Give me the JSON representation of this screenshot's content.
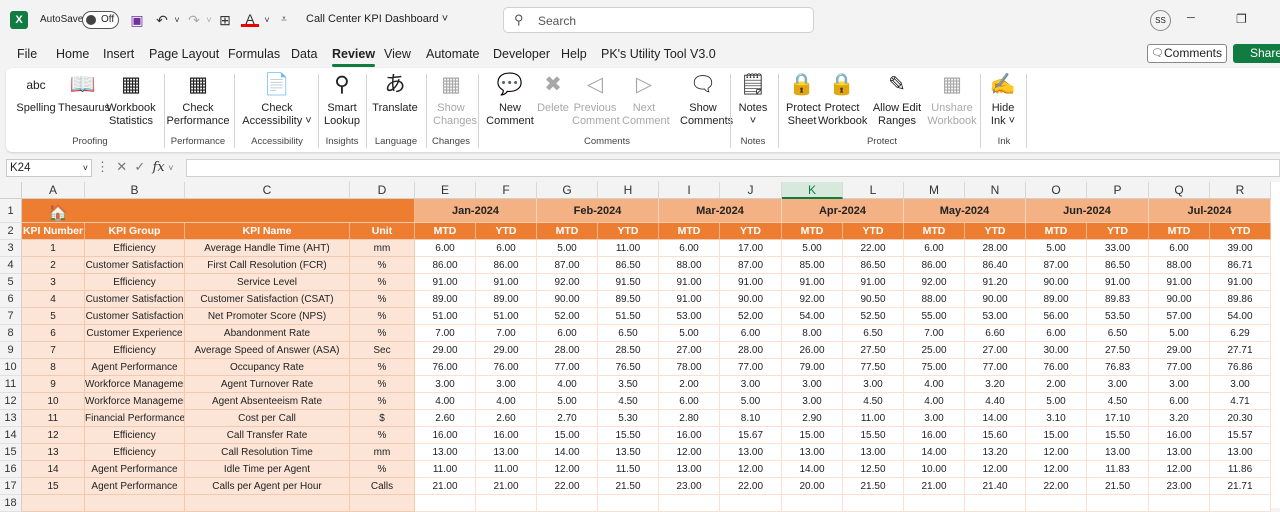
{
  "app": {
    "autosave_label": "AutoSave",
    "autosave_state": "Off",
    "doc_title": "Call Center KPI Dashboard",
    "search_placeholder": "Search",
    "user_initials": "SS"
  },
  "menu": [
    "File",
    "Home",
    "Insert",
    "Page Layout",
    "Formulas",
    "Data",
    "Review",
    "View",
    "Automate",
    "Developer",
    "Help",
    "PK's Utility Tool V3.0"
  ],
  "menu_active": "Review",
  "buttons": {
    "comments": "Comments",
    "share": "Share"
  },
  "ribbon": {
    "items": [
      {
        "l1": "Spelling",
        "l2": "",
        "icon": "spelling-icon",
        "g": "abc"
      },
      {
        "l1": "Thesaurus",
        "l2": "",
        "icon": "thesaurus-icon",
        "g": "📖"
      },
      {
        "l1": "Workbook",
        "l2": "Statistics",
        "icon": "statistics-icon",
        "g": "▦"
      },
      {
        "l1": "Check",
        "l2": "Performance",
        "icon": "performance-icon",
        "g": "▦"
      },
      {
        "l1": "Check",
        "l2": "Accessibility ˅",
        "icon": "accessibility-icon",
        "g": "📄"
      },
      {
        "l1": "Smart",
        "l2": "Lookup",
        "icon": "smart-lookup-icon",
        "g": "⚲"
      },
      {
        "l1": "Translate",
        "l2": "",
        "icon": "translate-icon",
        "g": "あ"
      },
      {
        "l1": "Show",
        "l2": "Changes",
        "icon": "show-changes-icon",
        "g": "▦",
        "dis": true
      },
      {
        "l1": "New",
        "l2": "Comment",
        "icon": "new-comment-icon",
        "g": "💬"
      },
      {
        "l1": "Delete",
        "l2": "",
        "icon": "delete-comment-icon",
        "g": "✖",
        "dis": true
      },
      {
        "l1": "Previous",
        "l2": "Comment",
        "icon": "previous-comment-icon",
        "g": "◁",
        "dis": true
      },
      {
        "l1": "Next",
        "l2": "Comment",
        "icon": "next-comment-icon",
        "g": "▷",
        "dis": true
      },
      {
        "l1": "Show",
        "l2": "Comments",
        "icon": "show-comments-icon",
        "g": "🗨"
      },
      {
        "l1": "Notes",
        "l2": "˅",
        "icon": "notes-icon",
        "g": "🗒"
      },
      {
        "l1": "Protect",
        "l2": "Sheet",
        "icon": "protect-sheet-icon",
        "g": "🔒"
      },
      {
        "l1": "Protect",
        "l2": "Workbook",
        "icon": "protect-workbook-icon",
        "g": "🔒"
      },
      {
        "l1": "Allow Edit",
        "l2": "Ranges",
        "icon": "allow-edit-ranges-icon",
        "g": "✎"
      },
      {
        "l1": "Unshare",
        "l2": "Workbook",
        "icon": "unshare-workbook-icon",
        "g": "▦",
        "dis": true
      },
      {
        "l1": "Hide",
        "l2": "Ink ˅",
        "icon": "hide-ink-icon",
        "g": "✍"
      }
    ],
    "groups": [
      "Proofing",
      "Performance",
      "Accessibility",
      "Insights",
      "Language",
      "Changes",
      "Comments",
      "Notes",
      "Protect",
      "Ink"
    ]
  },
  "formula_bar": {
    "name_box": "K24",
    "fx": "fx",
    "value": ""
  },
  "columns": [
    "A",
    "B",
    "C",
    "D",
    "E",
    "F",
    "G",
    "H",
    "I",
    "J",
    "K",
    "L",
    "M",
    "N",
    "O",
    "P",
    "Q",
    "R"
  ],
  "selected_column": "K",
  "rows": [
    "1",
    "2",
    "3",
    "4",
    "5",
    "6",
    "7",
    "8",
    "9",
    "10",
    "11",
    "12",
    "13",
    "14",
    "15",
    "16",
    "17",
    "18"
  ],
  "sheet": {
    "months": [
      "Jan-2024",
      "Feb-2024",
      "Mar-2024",
      "Apr-2024",
      "May-2024",
      "Jun-2024",
      "Jul-2024"
    ],
    "headers": [
      "KPI Number",
      "KPI Group",
      "KPI Name",
      "Unit"
    ],
    "mtd": "MTD",
    "ytd": "YTD",
    "kpis": [
      [
        "1",
        "Efficiency",
        "Average Handle Time (AHT)",
        "mm",
        "6.00",
        "6.00",
        "5.00",
        "11.00",
        "6.00",
        "17.00",
        "5.00",
        "22.00",
        "6.00",
        "28.00",
        "5.00",
        "33.00",
        "6.00",
        "39.00"
      ],
      [
        "2",
        "Customer Satisfaction",
        "First Call Resolution (FCR)",
        "%",
        "86.00",
        "86.00",
        "87.00",
        "86.50",
        "88.00",
        "87.00",
        "85.00",
        "86.50",
        "86.00",
        "86.40",
        "87.00",
        "86.50",
        "88.00",
        "86.71"
      ],
      [
        "3",
        "Efficiency",
        "Service Level",
        "%",
        "91.00",
        "91.00",
        "92.00",
        "91.50",
        "91.00",
        "91.00",
        "91.00",
        "91.00",
        "92.00",
        "91.20",
        "90.00",
        "91.00",
        "91.00",
        "91.00"
      ],
      [
        "4",
        "Customer Satisfaction",
        "Customer Satisfaction (CSAT)",
        "%",
        "89.00",
        "89.00",
        "90.00",
        "89.50",
        "91.00",
        "90.00",
        "92.00",
        "90.50",
        "88.00",
        "90.00",
        "89.00",
        "89.83",
        "90.00",
        "89.86"
      ],
      [
        "5",
        "Customer Satisfaction",
        "Net Promoter Score (NPS)",
        "%",
        "51.00",
        "51.00",
        "52.00",
        "51.50",
        "53.00",
        "52.00",
        "54.00",
        "52.50",
        "55.00",
        "53.00",
        "56.00",
        "53.50",
        "57.00",
        "54.00"
      ],
      [
        "6",
        "Customer Experience",
        "Abandonment Rate",
        "%",
        "7.00",
        "7.00",
        "6.00",
        "6.50",
        "5.00",
        "6.00",
        "8.00",
        "6.50",
        "7.00",
        "6.60",
        "6.00",
        "6.50",
        "5.00",
        "6.29"
      ],
      [
        "7",
        "Efficiency",
        "Average Speed of Answer (ASA)",
        "Sec",
        "29.00",
        "29.00",
        "28.00",
        "28.50",
        "27.00",
        "28.00",
        "26.00",
        "27.50",
        "25.00",
        "27.00",
        "30.00",
        "27.50",
        "29.00",
        "27.71"
      ],
      [
        "8",
        "Agent Performance",
        "Occupancy Rate",
        "%",
        "76.00",
        "76.00",
        "77.00",
        "76.50",
        "78.00",
        "77.00",
        "79.00",
        "77.50",
        "75.00",
        "77.00",
        "76.00",
        "76.83",
        "77.00",
        "76.86"
      ],
      [
        "9",
        "Workforce Management",
        "Agent Turnover Rate",
        "%",
        "3.00",
        "3.00",
        "4.00",
        "3.50",
        "2.00",
        "3.00",
        "3.00",
        "3.00",
        "4.00",
        "3.20",
        "2.00",
        "3.00",
        "3.00",
        "3.00"
      ],
      [
        "10",
        "Workforce Management",
        "Agent Absenteeism Rate",
        "%",
        "4.00",
        "4.00",
        "5.00",
        "4.50",
        "6.00",
        "5.00",
        "3.00",
        "4.50",
        "4.00",
        "4.40",
        "5.00",
        "4.50",
        "6.00",
        "4.71"
      ],
      [
        "11",
        "Financial Performance",
        "Cost per Call",
        "$",
        "2.60",
        "2.60",
        "2.70",
        "5.30",
        "2.80",
        "8.10",
        "2.90",
        "11.00",
        "3.00",
        "14.00",
        "3.10",
        "17.10",
        "3.20",
        "20.30"
      ],
      [
        "12",
        "Efficiency",
        "Call Transfer Rate",
        "%",
        "16.00",
        "16.00",
        "15.00",
        "15.50",
        "16.00",
        "15.67",
        "15.00",
        "15.50",
        "16.00",
        "15.60",
        "15.00",
        "15.50",
        "16.00",
        "15.57"
      ],
      [
        "13",
        "Efficiency",
        "Call Resolution Time",
        "mm",
        "13.00",
        "13.00",
        "14.00",
        "13.50",
        "12.00",
        "13.00",
        "13.00",
        "13.00",
        "14.00",
        "13.20",
        "12.00",
        "13.00",
        "13.00",
        "13.00"
      ],
      [
        "14",
        "Agent Performance",
        "Idle Time per Agent",
        "%",
        "11.00",
        "11.00",
        "12.00",
        "11.50",
        "13.00",
        "12.00",
        "14.00",
        "12.50",
        "10.00",
        "12.00",
        "12.00",
        "11.83",
        "12.00",
        "11.86"
      ],
      [
        "15",
        "Agent Performance",
        "Calls per Agent per Hour",
        "Calls",
        "21.00",
        "21.00",
        "22.00",
        "21.50",
        "23.00",
        "22.00",
        "20.00",
        "21.50",
        "21.00",
        "21.40",
        "22.00",
        "21.50",
        "23.00",
        "21.71"
      ]
    ]
  }
}
